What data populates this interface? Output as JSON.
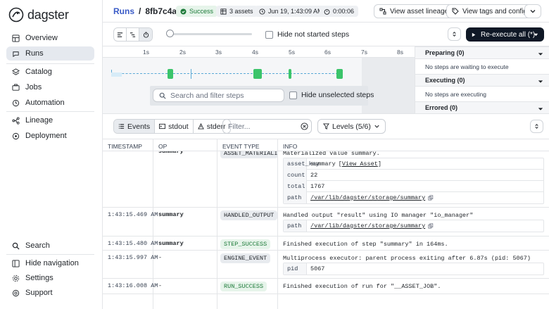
{
  "app": {
    "name": "dagster"
  },
  "sidebar": {
    "items": [
      {
        "label": "Overview",
        "icon": "overview-icon"
      },
      {
        "label": "Runs",
        "icon": "runs-icon",
        "active": true
      },
      {
        "label": "Catalog",
        "icon": "catalog-icon"
      },
      {
        "label": "Jobs",
        "icon": "jobs-icon"
      },
      {
        "label": "Automation",
        "icon": "automation-icon"
      },
      {
        "label": "Lineage",
        "icon": "lineage-icon"
      },
      {
        "label": "Deployment",
        "icon": "deployment-icon"
      }
    ],
    "bottom": [
      {
        "label": "Search",
        "icon": "search-icon"
      },
      {
        "label": "Hide navigation",
        "icon": "hide-nav-icon"
      },
      {
        "label": "Settings",
        "icon": "gear-icon"
      },
      {
        "label": "Support",
        "icon": "help-icon"
      }
    ]
  },
  "header": {
    "runs_label": "Runs",
    "separator": "/",
    "run_id": "8fb7c4ac",
    "status": "Success",
    "assets": "3 assets",
    "date": "Jun 19, 1:43:09 AM",
    "duration": "0:00:06",
    "lineage_button": "View asset lineage",
    "tags_button": "View tags and config"
  },
  "toolbar": {
    "hide_not_started": "Hide not started steps",
    "reexecute": "Re-execute all (*)"
  },
  "gantt": {
    "ticks": [
      "1s",
      "2s",
      "3s",
      "4s",
      "5s",
      "6s",
      "7s",
      "8s"
    ],
    "search_placeholder": "Search and filter steps",
    "hide_unselected": "Hide unselected steps"
  },
  "panel": {
    "preparing": "Preparing (0)",
    "preparing_msg": "No steps are waiting to execute",
    "executing": "Executing (0)",
    "executing_msg": "No steps are executing",
    "errored": "Errored (0)"
  },
  "logs": {
    "tabs": [
      "Events",
      "stdout",
      "stderr"
    ],
    "filter_placeholder": "Filter...",
    "levels": "Levels (5/6)"
  },
  "table": {
    "columns": [
      "TIMESTAMP",
      "OP",
      "EVENT TYPE",
      "INFO"
    ],
    "partial_row": {
      "op": "summary",
      "event": "ASSET_MATERIALI...",
      "info": "Materialized value summary.",
      "kv": [
        {
          "k": "asset_key",
          "v": "summary",
          "link": "View Asset"
        },
        {
          "k": "count",
          "v": "22"
        },
        {
          "k": "total",
          "v": "1767"
        },
        {
          "k": "path",
          "v": "/var/lib/dagster/storage/summary"
        }
      ]
    },
    "rows": [
      {
        "ts": "1:43:15.469 AM",
        "op": "summary",
        "event": "HANDLED_OUTPUT",
        "info": "Handled output \"result\" using IO manager \"io_manager\"",
        "kv": [
          {
            "k": "path",
            "v": "/var/lib/dagster/storage/summary"
          }
        ]
      },
      {
        "ts": "1:43:15.480 AM",
        "op": "summary",
        "event": "STEP_SUCCESS",
        "green": true,
        "info": "Finished execution of step \"summary\" in 164ms."
      },
      {
        "ts": "1:43:15.997 AM",
        "op": "-",
        "event": "ENGINE_EVENT",
        "info": "Multiprocess executor: parent process exiting after 6.87s (pid: 5067)",
        "kv": [
          {
            "k": "pid",
            "v": "5067"
          }
        ]
      },
      {
        "ts": "1:43:16.008 AM",
        "op": "-",
        "event": "RUN_SUCCESS",
        "green": true,
        "info": "Finished execution of run for \"__ASSET_JOB\"."
      }
    ]
  },
  "colors": {
    "accent": "#3a5bc7",
    "success": "#1e7b3a",
    "bar": "#3bc46a",
    "dark_button": "#0f1826"
  }
}
